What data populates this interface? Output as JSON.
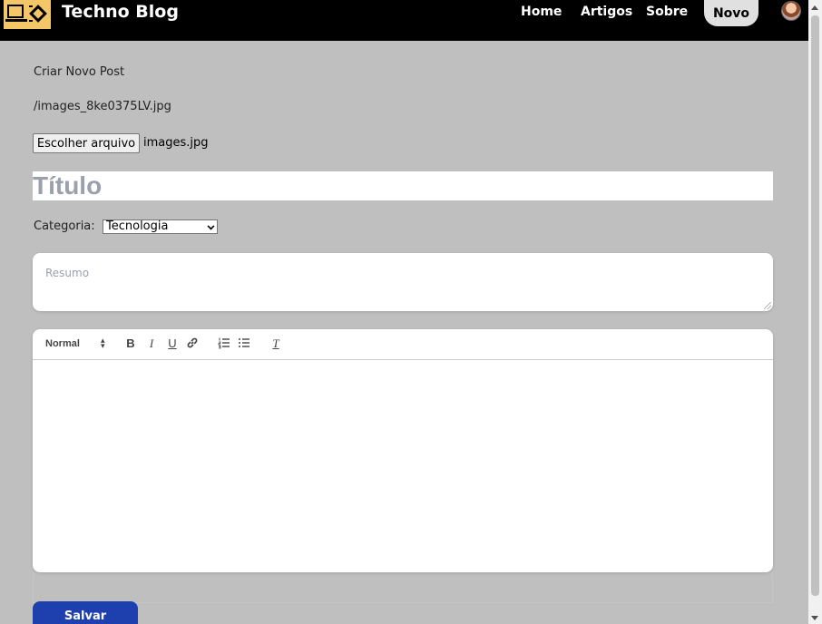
{
  "app": {
    "brand": "Techno Blog",
    "logo_icon": "laptop-chip-icon"
  },
  "nav": {
    "home": "Home",
    "artigos": "Artigos",
    "sobre": "Sobre",
    "novo": "Novo",
    "avatar_icon": "user-avatar-icon"
  },
  "form": {
    "heading": "Criar Novo Post",
    "file_path": "/images_8ke0375LV.jpg",
    "file_button": "Escolher arquivo",
    "file_name": "images.jpg",
    "title_placeholder": "Título",
    "category_label": "Categoria:",
    "category_selected": "Tecnologia",
    "summary_placeholder": "Resumo",
    "save_button": "Salvar"
  },
  "editor": {
    "format_selected": "Normal",
    "toolbar": {
      "bold": "B",
      "italic": "I",
      "underline": "U",
      "clean": "T"
    }
  },
  "colors": {
    "page_bg": "#bfbfbf",
    "navbar_bg": "#000000",
    "accent_button": "#1e40af",
    "logo_bg": "#f3c668"
  }
}
